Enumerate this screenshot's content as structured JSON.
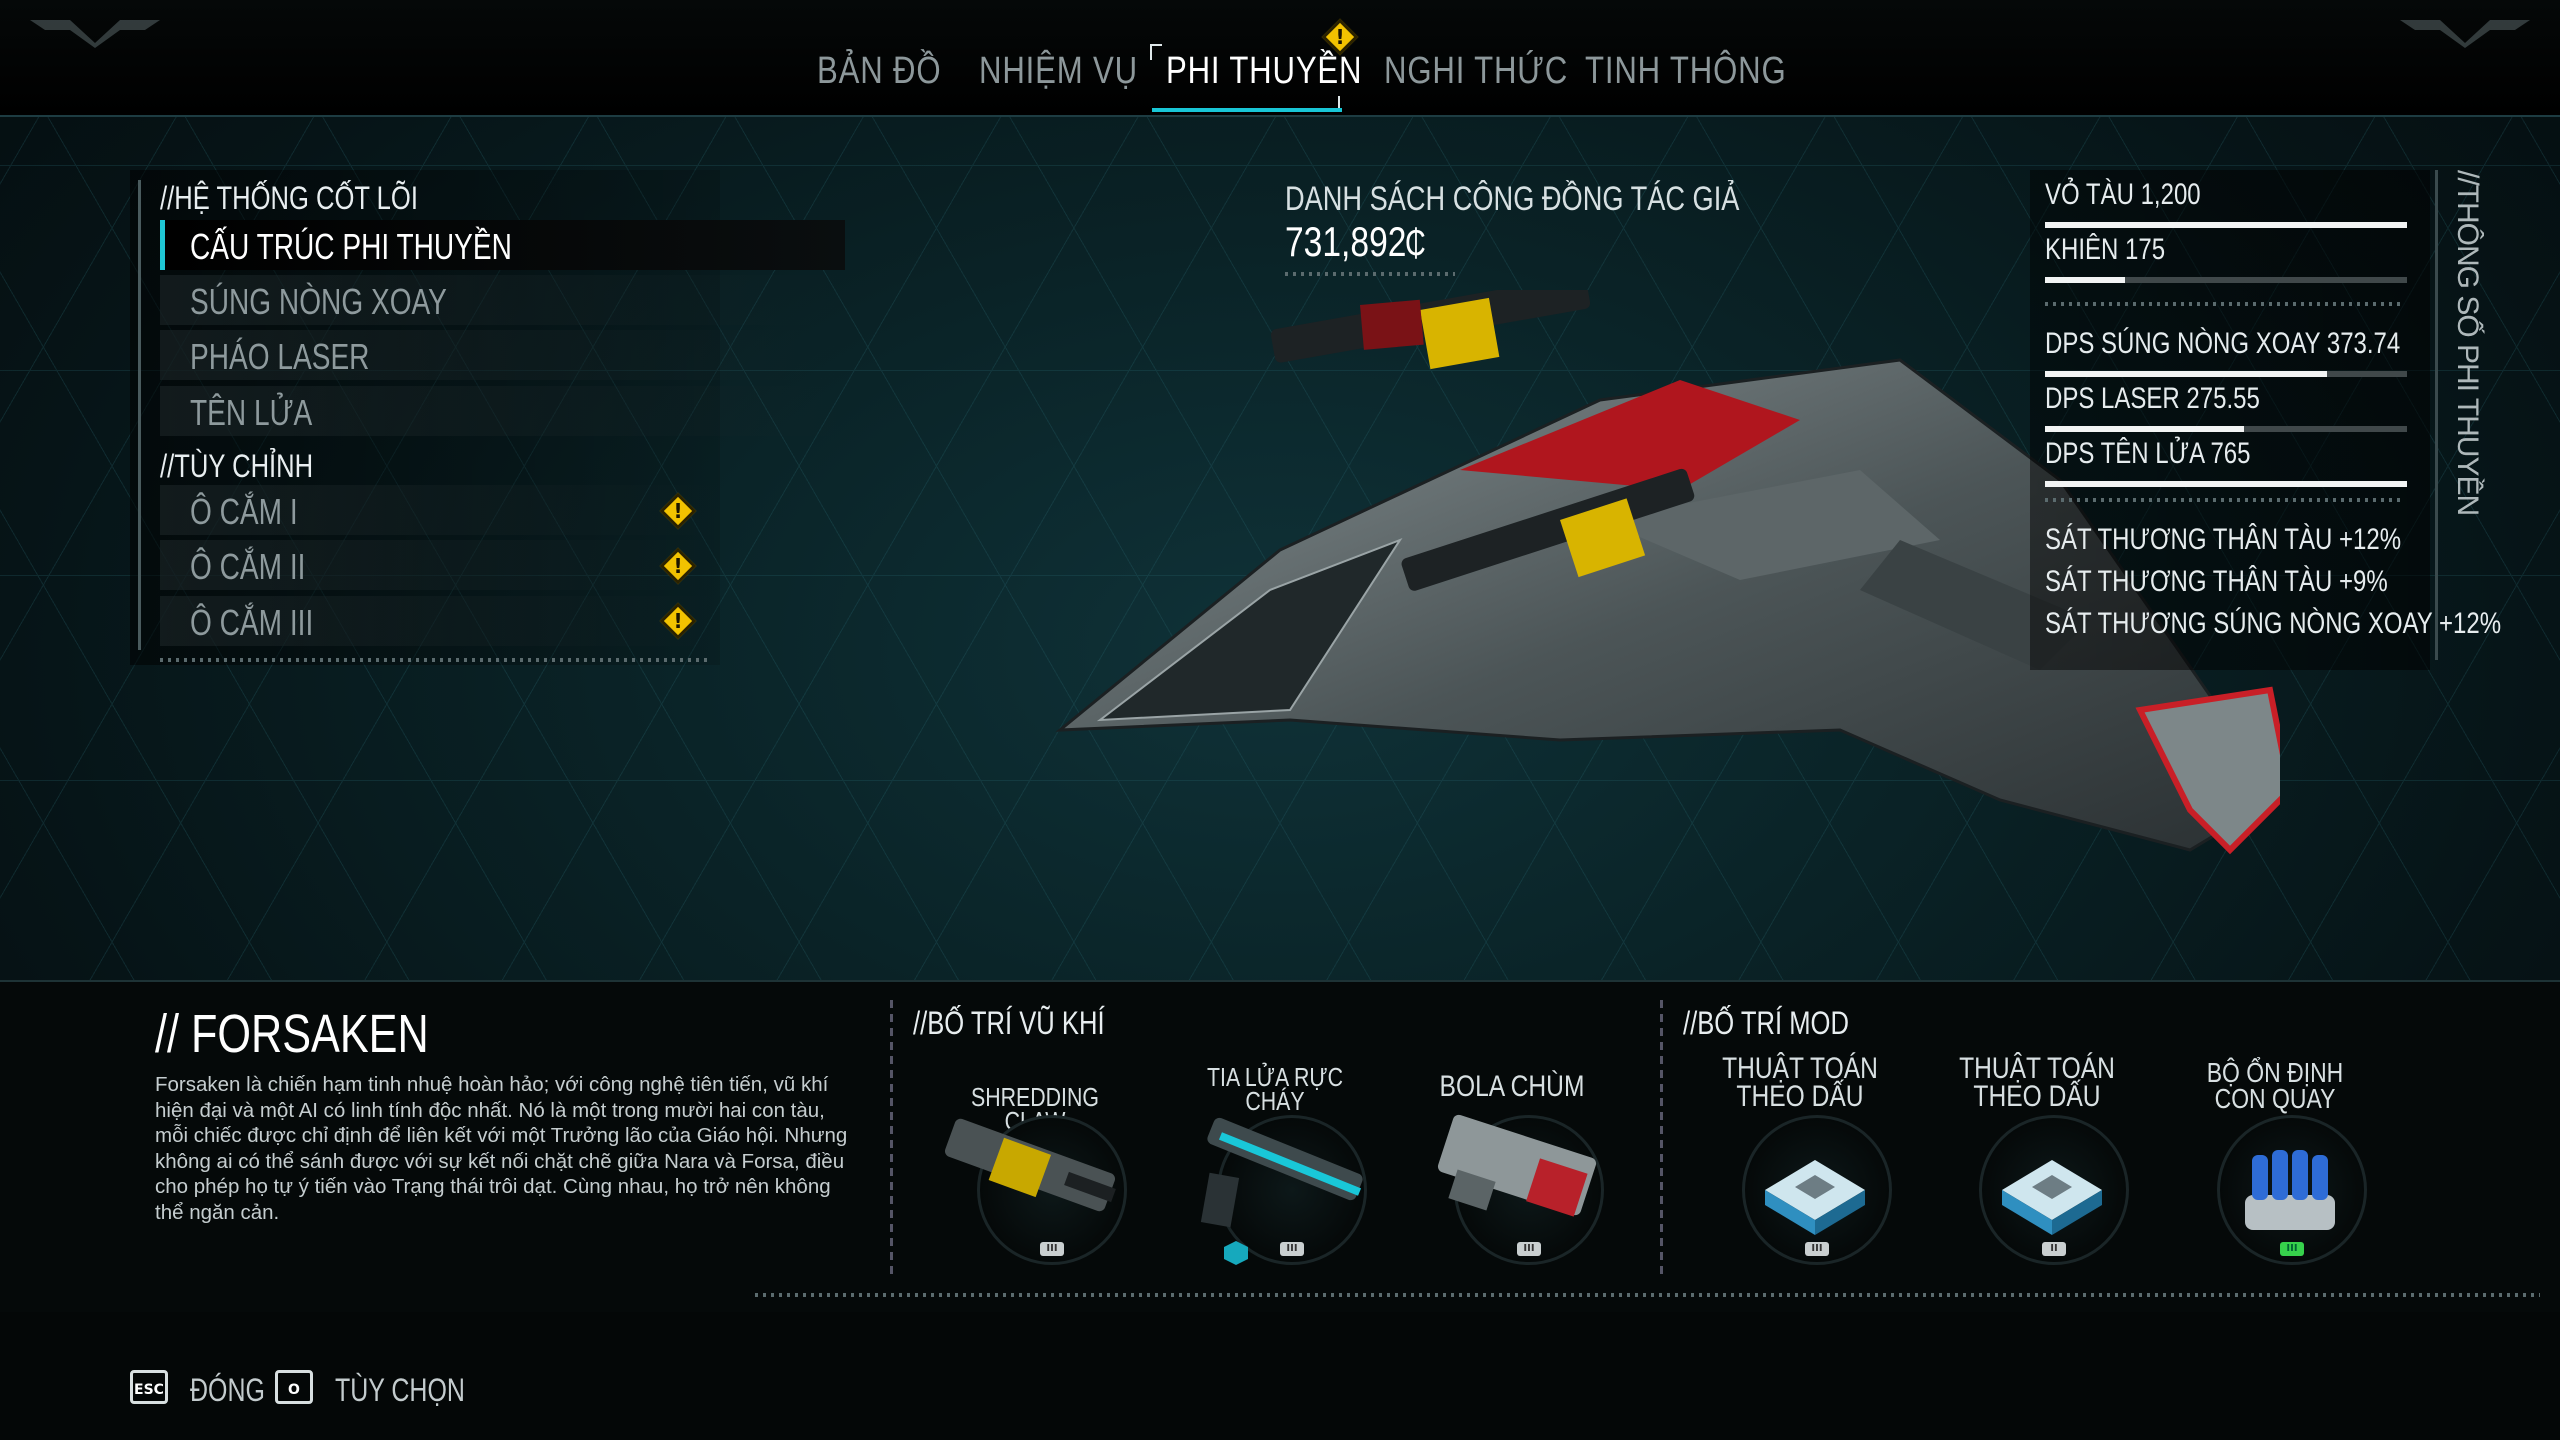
{
  "tabs": [
    {
      "label": "BẢN ĐỒ"
    },
    {
      "label": "NHIỆM VỤ"
    },
    {
      "label": "PHI THUYỀN"
    },
    {
      "label": "NGHI THỨC"
    },
    {
      "label": "TINH THÔNG"
    }
  ],
  "alert_glyph": "!",
  "colors": {
    "accent": "#18c6d6",
    "warning": "#f2c200",
    "active_text": "#ffffff"
  },
  "core": {
    "title": "//HỆ THỐNG CỐT LÕI",
    "items": [
      {
        "label": "CẤU TRÚC PHI THUYỀN",
        "selected": true
      },
      {
        "label": "SÚNG NÒNG XOAY"
      },
      {
        "label": "PHÁO LASER"
      },
      {
        "label": "TÊN LỬA"
      }
    ]
  },
  "custom": {
    "title": "//TÙY CHỈNH",
    "items": [
      {
        "label": "Ô CẮM I",
        "alert": true
      },
      {
        "label": "Ô CẮM II",
        "alert": true
      },
      {
        "label": "Ô CẮM III",
        "alert": true
      }
    ]
  },
  "community": {
    "title": "DANH SÁCH CÔNG ĐỒNG TÁC GIẢ",
    "value": "731,892",
    "currency_symbol": "₵"
  },
  "stats": {
    "title": "//THÔNG SỐ PHI THUYỀN",
    "hull": {
      "label": "VỎ TÀU",
      "value": "1,200",
      "fill": 1.0
    },
    "shield": {
      "label": "KHIÊN",
      "value": "175",
      "fill": 0.22
    },
    "dps_gatling": {
      "label": "DPS SÚNG NÒNG XOAY",
      "value": "373.74",
      "fill": 0.78
    },
    "dps_laser": {
      "label": "DPS LASER",
      "value": "275.55",
      "fill": 0.55
    },
    "dps_missile": {
      "label": "DPS TÊN LỬA",
      "value": "765",
      "fill": 1.0
    },
    "bonuses": [
      "SÁT THƯƠNG THÂN TÀU +12%",
      "SÁT THƯƠNG THÂN TÀU +9%",
      "SÁT THƯƠNG SÚNG NÒNG XOAY +12%"
    ]
  },
  "ship": {
    "name": "// FORSAKEN",
    "description": "Forsaken là chiến hạm tinh nhuệ hoàn hảo; với công nghệ tiên tiến, vũ khí hiện đại và một AI có linh tính độc nhất. Nó là một trong mười hai con tàu, mỗi chiếc được chỉ định để liên kết với một Trưởng lão của Giáo hội. Nhưng không ai có thể sánh được với sự kết nối chặt chẽ giữa Nara và Forsa, điều cho phép họ tự ý tiến vào Trạng thái trôi dạt. Cùng nhau, họ trở nên không thể ngăn cản."
  },
  "weapons": {
    "title": "//BỐ TRÍ VŨ KHÍ",
    "items": [
      {
        "name": "SHREDDING CLAW",
        "tier": "III"
      },
      {
        "name": "TIA LỬA RỰC CHÁY",
        "tier": "III"
      },
      {
        "name": "BOLA CHÙM",
        "tier": "III"
      }
    ]
  },
  "mods": {
    "title": "//BỐ TRÍ MOD",
    "items": [
      {
        "name": "THUẬT TOÁN THEO DẤU",
        "tier": "III"
      },
      {
        "name": "THUẬT TOÁN THEO DẤU",
        "tier": "II"
      },
      {
        "name": "BỘ ỔN ĐỊNH CON QUAY",
        "tier": "III"
      }
    ]
  },
  "footer": {
    "esc_key": "ESC",
    "close_label": "ĐÓNG",
    "options_key": "O",
    "options_label": "TÙY CHỌN"
  }
}
